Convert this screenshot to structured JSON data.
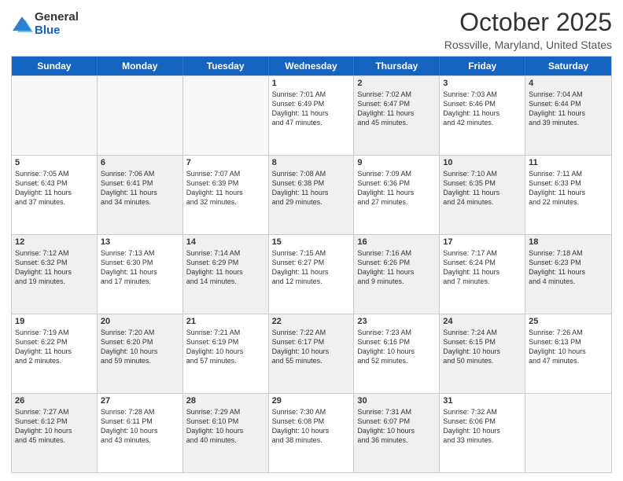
{
  "logo": {
    "general": "General",
    "blue": "Blue"
  },
  "header": {
    "month": "October 2025",
    "location": "Rossville, Maryland, United States"
  },
  "days": [
    "Sunday",
    "Monday",
    "Tuesday",
    "Wednesday",
    "Thursday",
    "Friday",
    "Saturday"
  ],
  "rows": [
    [
      {
        "day": "",
        "info": "",
        "empty": true
      },
      {
        "day": "",
        "info": "",
        "empty": true
      },
      {
        "day": "",
        "info": "",
        "empty": true
      },
      {
        "day": "1",
        "info": "Sunrise: 7:01 AM\nSunset: 6:49 PM\nDaylight: 11 hours\nand 47 minutes."
      },
      {
        "day": "2",
        "info": "Sunrise: 7:02 AM\nSunset: 6:47 PM\nDaylight: 11 hours\nand 45 minutes."
      },
      {
        "day": "3",
        "info": "Sunrise: 7:03 AM\nSunset: 6:46 PM\nDaylight: 11 hours\nand 42 minutes."
      },
      {
        "day": "4",
        "info": "Sunrise: 7:04 AM\nSunset: 6:44 PM\nDaylight: 11 hours\nand 39 minutes."
      }
    ],
    [
      {
        "day": "5",
        "info": "Sunrise: 7:05 AM\nSunset: 6:43 PM\nDaylight: 11 hours\nand 37 minutes."
      },
      {
        "day": "6",
        "info": "Sunrise: 7:06 AM\nSunset: 6:41 PM\nDaylight: 11 hours\nand 34 minutes."
      },
      {
        "day": "7",
        "info": "Sunrise: 7:07 AM\nSunset: 6:39 PM\nDaylight: 11 hours\nand 32 minutes."
      },
      {
        "day": "8",
        "info": "Sunrise: 7:08 AM\nSunset: 6:38 PM\nDaylight: 11 hours\nand 29 minutes."
      },
      {
        "day": "9",
        "info": "Sunrise: 7:09 AM\nSunset: 6:36 PM\nDaylight: 11 hours\nand 27 minutes."
      },
      {
        "day": "10",
        "info": "Sunrise: 7:10 AM\nSunset: 6:35 PM\nDaylight: 11 hours\nand 24 minutes."
      },
      {
        "day": "11",
        "info": "Sunrise: 7:11 AM\nSunset: 6:33 PM\nDaylight: 11 hours\nand 22 minutes."
      }
    ],
    [
      {
        "day": "12",
        "info": "Sunrise: 7:12 AM\nSunset: 6:32 PM\nDaylight: 11 hours\nand 19 minutes."
      },
      {
        "day": "13",
        "info": "Sunrise: 7:13 AM\nSunset: 6:30 PM\nDaylight: 11 hours\nand 17 minutes."
      },
      {
        "day": "14",
        "info": "Sunrise: 7:14 AM\nSunset: 6:29 PM\nDaylight: 11 hours\nand 14 minutes."
      },
      {
        "day": "15",
        "info": "Sunrise: 7:15 AM\nSunset: 6:27 PM\nDaylight: 11 hours\nand 12 minutes."
      },
      {
        "day": "16",
        "info": "Sunrise: 7:16 AM\nSunset: 6:26 PM\nDaylight: 11 hours\nand 9 minutes."
      },
      {
        "day": "17",
        "info": "Sunrise: 7:17 AM\nSunset: 6:24 PM\nDaylight: 11 hours\nand 7 minutes."
      },
      {
        "day": "18",
        "info": "Sunrise: 7:18 AM\nSunset: 6:23 PM\nDaylight: 11 hours\nand 4 minutes."
      }
    ],
    [
      {
        "day": "19",
        "info": "Sunrise: 7:19 AM\nSunset: 6:22 PM\nDaylight: 11 hours\nand 2 minutes."
      },
      {
        "day": "20",
        "info": "Sunrise: 7:20 AM\nSunset: 6:20 PM\nDaylight: 10 hours\nand 59 minutes."
      },
      {
        "day": "21",
        "info": "Sunrise: 7:21 AM\nSunset: 6:19 PM\nDaylight: 10 hours\nand 57 minutes."
      },
      {
        "day": "22",
        "info": "Sunrise: 7:22 AM\nSunset: 6:17 PM\nDaylight: 10 hours\nand 55 minutes."
      },
      {
        "day": "23",
        "info": "Sunrise: 7:23 AM\nSunset: 6:16 PM\nDaylight: 10 hours\nand 52 minutes."
      },
      {
        "day": "24",
        "info": "Sunrise: 7:24 AM\nSunset: 6:15 PM\nDaylight: 10 hours\nand 50 minutes."
      },
      {
        "day": "25",
        "info": "Sunrise: 7:26 AM\nSunset: 6:13 PM\nDaylight: 10 hours\nand 47 minutes."
      }
    ],
    [
      {
        "day": "26",
        "info": "Sunrise: 7:27 AM\nSunset: 6:12 PM\nDaylight: 10 hours\nand 45 minutes."
      },
      {
        "day": "27",
        "info": "Sunrise: 7:28 AM\nSunset: 6:11 PM\nDaylight: 10 hours\nand 43 minutes."
      },
      {
        "day": "28",
        "info": "Sunrise: 7:29 AM\nSunset: 6:10 PM\nDaylight: 10 hours\nand 40 minutes."
      },
      {
        "day": "29",
        "info": "Sunrise: 7:30 AM\nSunset: 6:08 PM\nDaylight: 10 hours\nand 38 minutes."
      },
      {
        "day": "30",
        "info": "Sunrise: 7:31 AM\nSunset: 6:07 PM\nDaylight: 10 hours\nand 36 minutes."
      },
      {
        "day": "31",
        "info": "Sunrise: 7:32 AM\nSunset: 6:06 PM\nDaylight: 10 hours\nand 33 minutes."
      },
      {
        "day": "",
        "info": "",
        "empty": true
      }
    ]
  ]
}
